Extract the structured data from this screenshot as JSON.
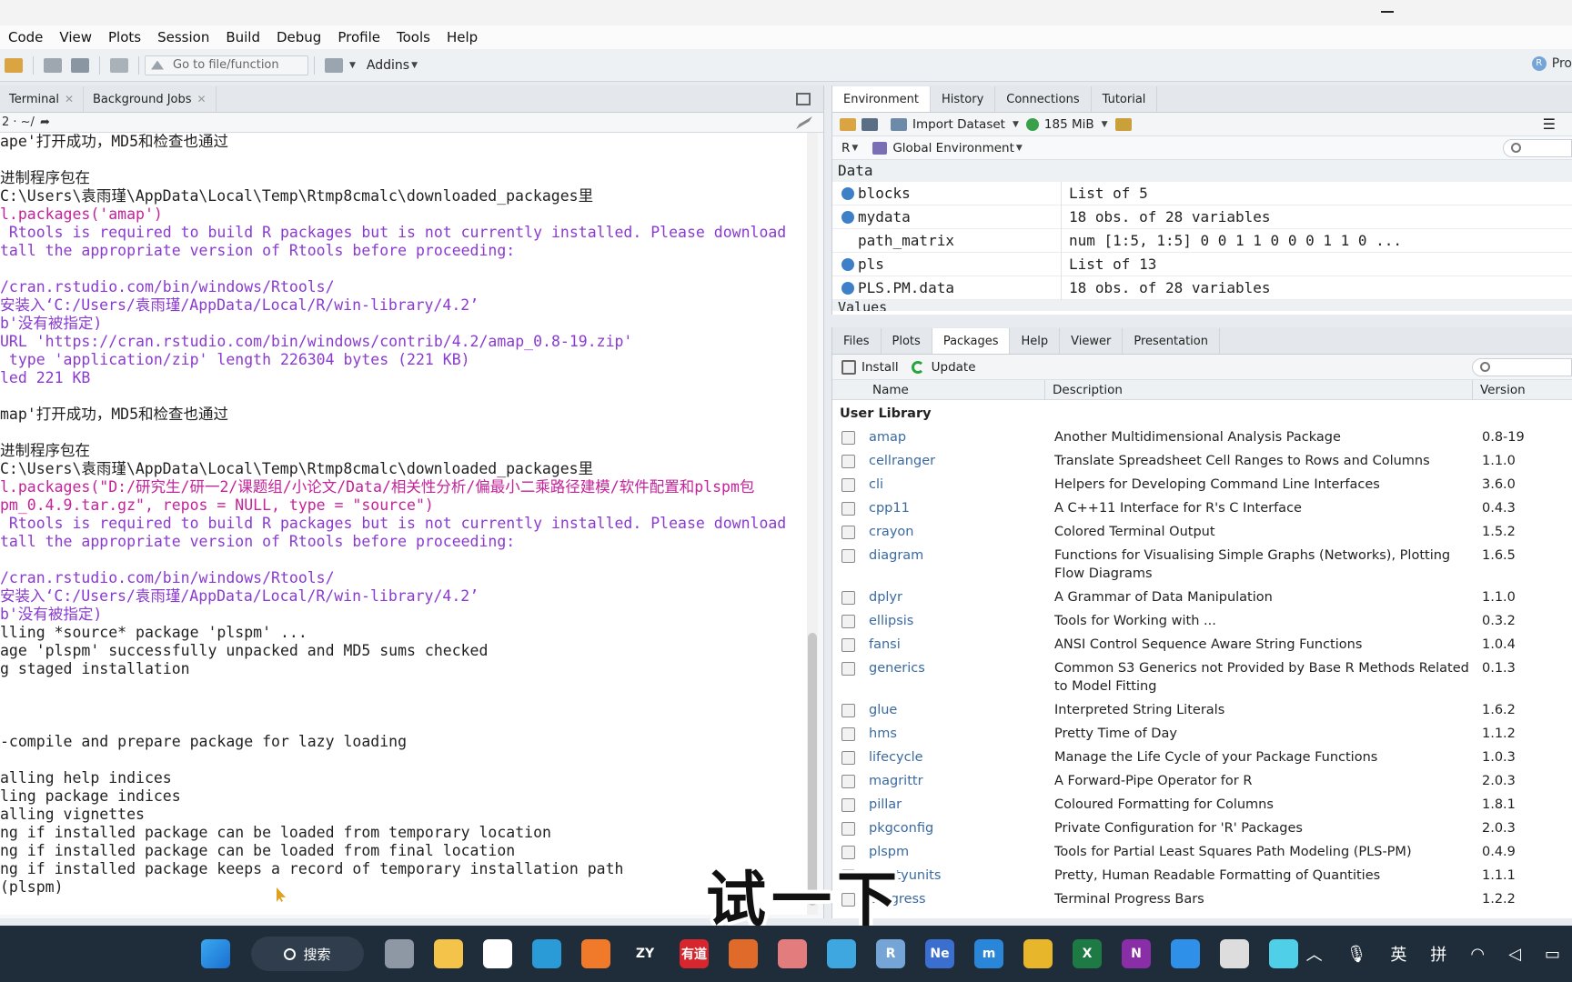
{
  "menu": [
    "Code",
    "View",
    "Plots",
    "Session",
    "Build",
    "Debug",
    "Profile",
    "Tools",
    "Help"
  ],
  "toolbar": {
    "goto_placeholder": "Go to file/function",
    "addins_label": "Addins",
    "project_label": "Pro"
  },
  "left_pane": {
    "tabs": [
      "Terminal",
      "Background Jobs"
    ],
    "path": "2 · ~/",
    "console_lines": [
      {
        "t": "ape'打开成功，MD5和检查也通过",
        "k": "msg"
      },
      {
        "t": "",
        "k": "msg"
      },
      {
        "t": "进制程序包在",
        "k": "msg"
      },
      {
        "t": "C:\\Users\\袁雨瑾\\AppData\\Local\\Temp\\Rtmp8cmalc\\downloaded_packages里",
        "k": "msg"
      },
      {
        "t": "l.packages('amap')",
        "k": "cmd"
      },
      {
        "t": " Rtools is required to build R packages but is not currently installed. Please download",
        "k": "warn"
      },
      {
        "t": "tall the appropriate version of Rtools before proceeding:",
        "k": "warn"
      },
      {
        "t": "",
        "k": "msg"
      },
      {
        "t": "/cran.rstudio.com/bin/windows/Rtools/",
        "k": "warn"
      },
      {
        "t": "安装入‘C:/Users/袁雨瑾/AppData/Local/R/win-library/4.2’",
        "k": "warn"
      },
      {
        "t": "b'没有被指定)",
        "k": "warn"
      },
      {
        "t": "URL 'https://cran.rstudio.com/bin/windows/contrib/4.2/amap_0.8-19.zip'",
        "k": "warn"
      },
      {
        "t": " type 'application/zip' length 226304 bytes (221 KB)",
        "k": "warn"
      },
      {
        "t": "led 221 KB",
        "k": "warn"
      },
      {
        "t": "",
        "k": "msg"
      },
      {
        "t": "map'打开成功，MD5和检查也通过",
        "k": "msg"
      },
      {
        "t": "",
        "k": "msg"
      },
      {
        "t": "进制程序包在",
        "k": "msg"
      },
      {
        "t": "C:\\Users\\袁雨瑾\\AppData\\Local\\Temp\\Rtmp8cmalc\\downloaded_packages里",
        "k": "msg"
      },
      {
        "t": "l.packages(\"D:/研究生/研一2/课题组/小论文/Data/相关性分析/偏最小二乘路径建模/软件配置和plspm包",
        "k": "cmd"
      },
      {
        "t": "pm_0.4.9.tar.gz\", repos = NULL, type = \"source\")",
        "k": "cmd"
      },
      {
        "t": " Rtools is required to build R packages but is not currently installed. Please download",
        "k": "warn"
      },
      {
        "t": "tall the appropriate version of Rtools before proceeding:",
        "k": "warn"
      },
      {
        "t": "",
        "k": "msg"
      },
      {
        "t": "/cran.rstudio.com/bin/windows/Rtools/",
        "k": "warn"
      },
      {
        "t": "安装入‘C:/Users/袁雨瑾/AppData/Local/R/win-library/4.2’",
        "k": "warn"
      },
      {
        "t": "b'没有被指定)",
        "k": "warn"
      },
      {
        "t": "lling *source* package 'plspm' ...",
        "k": "msg"
      },
      {
        "t": "age 'plspm' successfully unpacked and MD5 sums checked",
        "k": "msg"
      },
      {
        "t": "g staged installation",
        "k": "msg"
      },
      {
        "t": "",
        "k": "msg"
      },
      {
        "t": "",
        "k": "msg"
      },
      {
        "t": "",
        "k": "msg"
      },
      {
        "t": "-compile and prepare package for lazy loading",
        "k": "msg"
      },
      {
        "t": "",
        "k": "msg"
      },
      {
        "t": "alling help indices",
        "k": "msg"
      },
      {
        "t": "ling package indices",
        "k": "msg"
      },
      {
        "t": "alling vignettes",
        "k": "msg"
      },
      {
        "t": "ng if installed package can be loaded from temporary location",
        "k": "msg"
      },
      {
        "t": "ng if installed package can be loaded from final location",
        "k": "msg"
      },
      {
        "t": "ng if installed package keeps a record of temporary installation path",
        "k": "msg"
      },
      {
        "t": "(plspm)",
        "k": "msg"
      }
    ]
  },
  "env_pane": {
    "tabs": [
      "Environment",
      "History",
      "Connections",
      "Tutorial"
    ],
    "import_label": "Import Dataset",
    "memory_label": "185 MiB",
    "lang_label": "R",
    "scope_label": "Global Environment",
    "data_header": "Data",
    "values_header": "Values",
    "rows": [
      {
        "name": "blocks",
        "value": "List of  5",
        "bullet": true
      },
      {
        "name": "mydata",
        "value": "18 obs. of 28 variables",
        "bullet": true
      },
      {
        "name": "path_matrix",
        "value": "num [1:5, 1:5] 0 0 1 1 0 0 0 1 1 0 ...",
        "bullet": false
      },
      {
        "name": "pls",
        "value": "List of  13",
        "bullet": true
      },
      {
        "name": "PLS.PM.data",
        "value": "18 obs. of 28 variables",
        "bullet": true
      }
    ]
  },
  "packages_pane": {
    "tabs": [
      "Files",
      "Plots",
      "Packages",
      "Help",
      "Viewer",
      "Presentation"
    ],
    "install_label": "Install",
    "update_label": "Update",
    "col_name": "Name",
    "col_desc": "Description",
    "col_ver": "Version",
    "library_header": "User Library",
    "packages": [
      {
        "name": "amap",
        "desc": "Another Multidimensional Analysis Package",
        "ver": "0.8-19"
      },
      {
        "name": "cellranger",
        "desc": "Translate Spreadsheet Cell Ranges to Rows and Columns",
        "ver": "1.1.0"
      },
      {
        "name": "cli",
        "desc": "Helpers for Developing Command Line Interfaces",
        "ver": "3.6.0"
      },
      {
        "name": "cpp11",
        "desc": "A C++11 Interface for R's C Interface",
        "ver": "0.4.3"
      },
      {
        "name": "crayon",
        "desc": "Colored Terminal Output",
        "ver": "1.5.2"
      },
      {
        "name": "diagram",
        "desc": "Functions for Visualising Simple Graphs (Networks), Plotting Flow Diagrams",
        "ver": "1.6.5"
      },
      {
        "name": "dplyr",
        "desc": "A Grammar of Data Manipulation",
        "ver": "1.1.0"
      },
      {
        "name": "ellipsis",
        "desc": "Tools for Working with ...",
        "ver": "0.3.2"
      },
      {
        "name": "fansi",
        "desc": "ANSI Control Sequence Aware String Functions",
        "ver": "1.0.4"
      },
      {
        "name": "generics",
        "desc": "Common S3 Generics not Provided by Base R Methods Related to Model Fitting",
        "ver": "0.1.3"
      },
      {
        "name": "glue",
        "desc": "Interpreted String Literals",
        "ver": "1.6.2"
      },
      {
        "name": "hms",
        "desc": "Pretty Time of Day",
        "ver": "1.1.2"
      },
      {
        "name": "lifecycle",
        "desc": "Manage the Life Cycle of your Package Functions",
        "ver": "1.0.3"
      },
      {
        "name": "magrittr",
        "desc": "A Forward-Pipe Operator for R",
        "ver": "2.0.3"
      },
      {
        "name": "pillar",
        "desc": "Coloured Formatting for Columns",
        "ver": "1.8.1"
      },
      {
        "name": "pkgconfig",
        "desc": "Private Configuration for 'R' Packages",
        "ver": "2.0.3"
      },
      {
        "name": "plspm",
        "desc": "Tools for Partial Least Squares Path Modeling (PLS-PM)",
        "ver": "0.4.9"
      },
      {
        "name": "prettyunits",
        "desc": "Pretty, Human Readable Formatting of Quantities",
        "ver": "1.1.1"
      },
      {
        "name": "progress",
        "desc": "Terminal Progress Bars",
        "ver": "1.2.2"
      }
    ]
  },
  "subtitle": "试一下",
  "taskbar": {
    "search_label": "搜索",
    "apps": [
      {
        "name": "file-explorer-icon",
        "color": "#f4c44a",
        "label": ""
      },
      {
        "name": "store-icon",
        "color": "#ffffff",
        "label": ""
      },
      {
        "name": "edge-icon",
        "color": "#2b9bd8",
        "label": ""
      },
      {
        "name": "firefox-icon",
        "color": "#f07a2a",
        "label": ""
      },
      {
        "name": "zy-icon",
        "color": "#1f2c3a",
        "label": "ZY"
      },
      {
        "name": "youdao-icon",
        "color": "#d7262e",
        "label": "有道"
      },
      {
        "name": "matlab-icon",
        "color": "#e06a2a",
        "label": ""
      },
      {
        "name": "image-app-icon",
        "color": "#e37c7c",
        "label": ""
      },
      {
        "name": "drive-icon",
        "color": "#3fa7e0",
        "label": ""
      },
      {
        "name": "rstudio-icon",
        "color": "#75a5d6",
        "label": "R"
      },
      {
        "name": "notepad-icon",
        "color": "#3a6fd0",
        "label": "Ne"
      },
      {
        "name": "app-m-icon",
        "color": "#2a86d8",
        "label": "m"
      },
      {
        "name": "office-tiles-icon",
        "color": "#e8b62a",
        "label": ""
      },
      {
        "name": "excel-icon",
        "color": "#1e7a44",
        "label": "X"
      },
      {
        "name": "onenote-icon",
        "color": "#8a2ea8",
        "label": "N"
      },
      {
        "name": "chat-icon",
        "color": "#2e90e8",
        "label": ""
      },
      {
        "name": "chatgpt-icon",
        "color": "#dddddd",
        "label": ""
      },
      {
        "name": "notes-icon",
        "color": "#4fd0e8",
        "label": ""
      }
    ],
    "tray": {
      "ime1": "英",
      "ime2": "拼"
    }
  }
}
